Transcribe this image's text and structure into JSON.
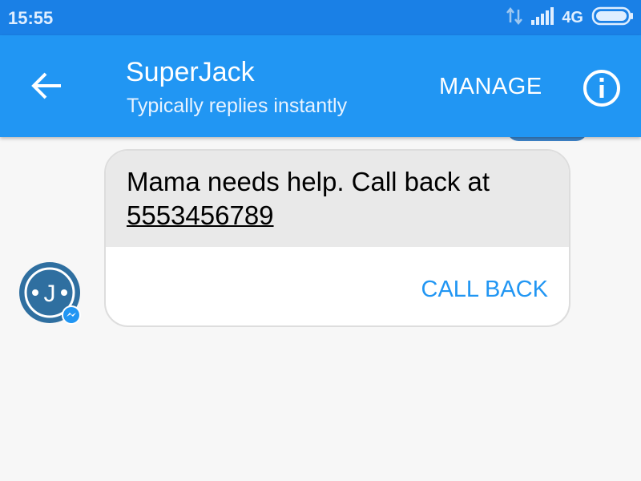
{
  "status_bar": {
    "time": "15:55",
    "network": "4G",
    "icons": [
      "data-transfer-icon",
      "signal-icon",
      "battery-icon"
    ]
  },
  "header": {
    "title": "SuperJack",
    "subtitle": "Typically replies instantly",
    "manage_label": "MANAGE",
    "icons": [
      "back-arrow-icon",
      "info-icon"
    ]
  },
  "message": {
    "text": "Mama needs help. Call back at",
    "phone": "5553456789",
    "action_label": "CALL BACK"
  },
  "avatar": {
    "initial": "J",
    "badge_icon": "messenger-icon"
  },
  "colors": {
    "status_bar": "#1a80e6",
    "app_bar": "#2196f3",
    "accent": "#2196f3",
    "bubble": "#e9e9e9",
    "avatar": "#2f6fa0"
  }
}
